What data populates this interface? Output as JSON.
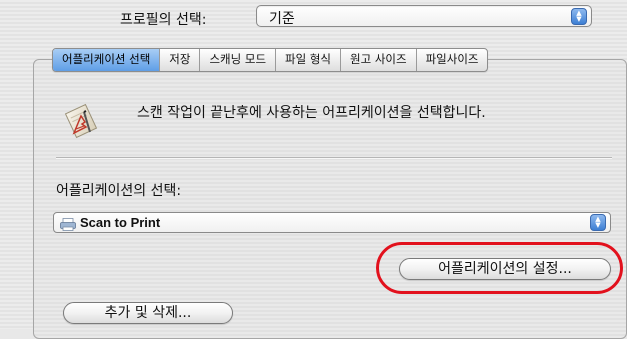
{
  "profile": {
    "label": "프로필의 선택:",
    "value": "기준"
  },
  "tabs": [
    {
      "label": "어플리케이션 선택",
      "active": true
    },
    {
      "label": "저장",
      "active": false
    },
    {
      "label": "스캐닝 모드",
      "active": false
    },
    {
      "label": "파일 형식",
      "active": false
    },
    {
      "label": "원고 사이즈",
      "active": false
    },
    {
      "label": "파일사이즈",
      "active": false
    }
  ],
  "main": {
    "icon": "application-pen-icon",
    "description": "스캔 작업이 끝난후에 사용하는 어프리케이션을 선택합니다.",
    "app_select_label": "어플리케이션의 선택:",
    "app_select_value": "Scan to Print",
    "app_select_icon": "printer-icon",
    "settings_button": "어플리케이션의 설정...",
    "add_remove_button": "추가 및 삭제..."
  },
  "colors": {
    "highlight": "#e2111d",
    "tab_active": "#5f9ee6",
    "stepper": "#3d7fd4"
  }
}
